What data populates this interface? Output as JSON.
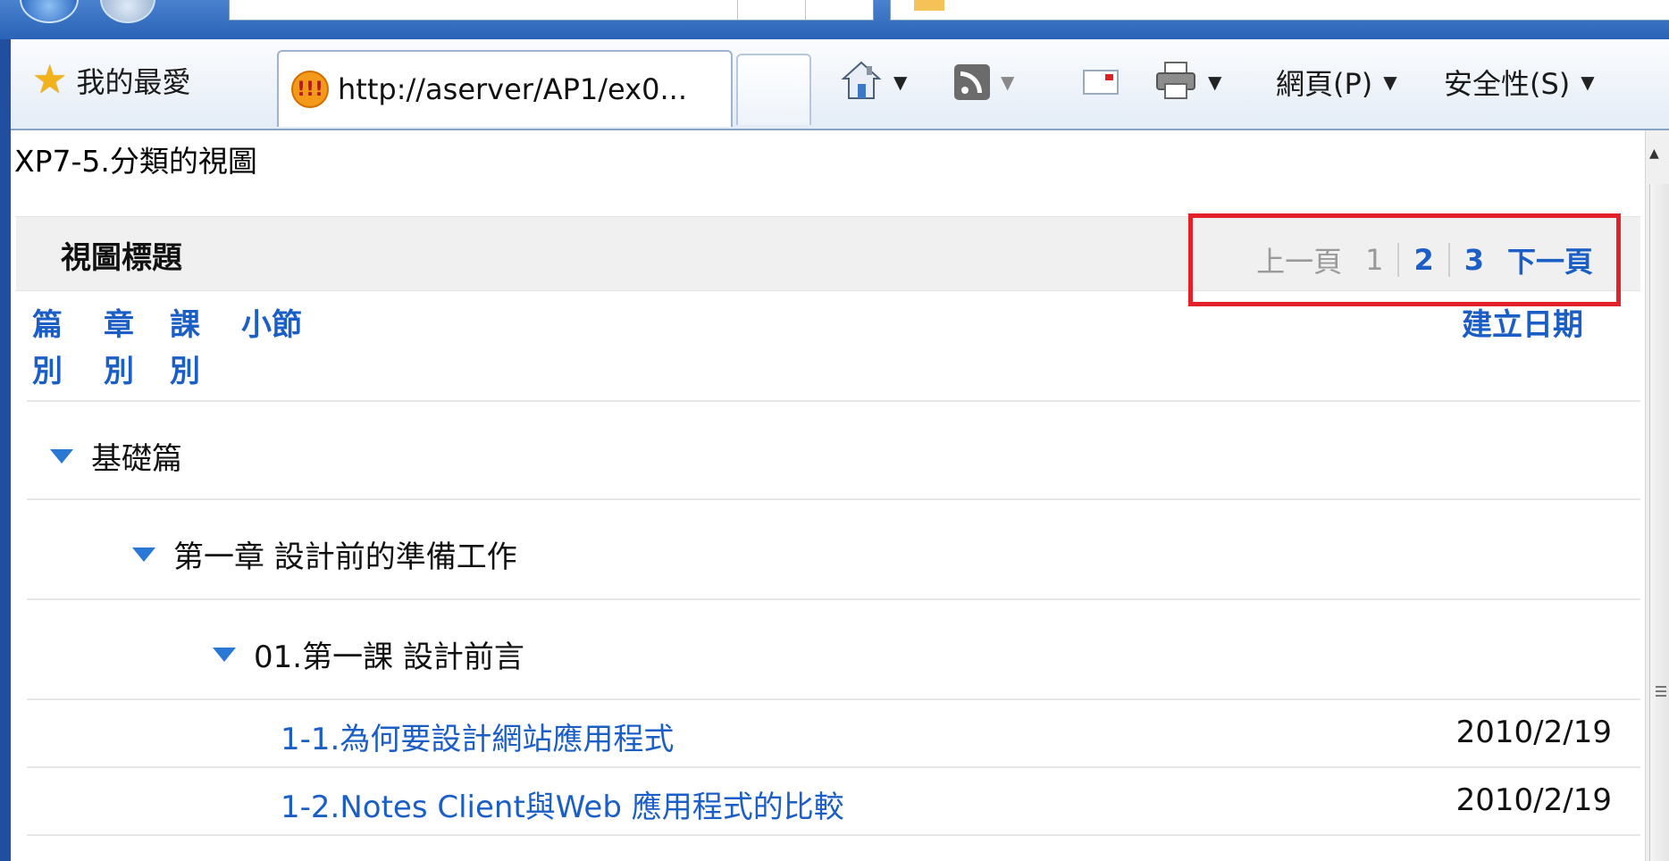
{
  "browser": {
    "favorites_label": "我的最愛",
    "tab_title": "http://aserver/AP1/ex0...",
    "tab_icon_glyph": "!!!",
    "toolbar": {
      "page_menu": "網頁(P)",
      "safety_menu": "安全性(S)"
    },
    "icons": [
      "star-icon",
      "site-icon",
      "home-icon",
      "rss-feed-icon",
      "read-mail-icon",
      "print-icon"
    ]
  },
  "page": {
    "caption": "XP7-5.分類的視圖",
    "view_title": "視圖標題",
    "pager": {
      "prev": "上一頁",
      "pages": [
        "1",
        "2",
        "3"
      ],
      "current_page": "1",
      "next": "下一頁"
    },
    "columns": {
      "part": "篇別",
      "chapter": "章別",
      "lesson": "課別",
      "section": "小節",
      "date": "建立日期"
    },
    "categories": {
      "level1": "基礎篇",
      "level2": "第一章 設計前的準備工作",
      "level3": "01.第一課 設計前言"
    },
    "documents": [
      {
        "title": "1-1.為何要設計網站應用程式",
        "date": "2010/2/19"
      },
      {
        "title": "1-2.Notes Client與Web 應用程式的比較",
        "date": "2010/2/19"
      }
    ]
  },
  "colors": {
    "link_blue": "#1b5ec5",
    "highlight_red": "#e3212b",
    "twisty_blue": "#2a78d6"
  }
}
